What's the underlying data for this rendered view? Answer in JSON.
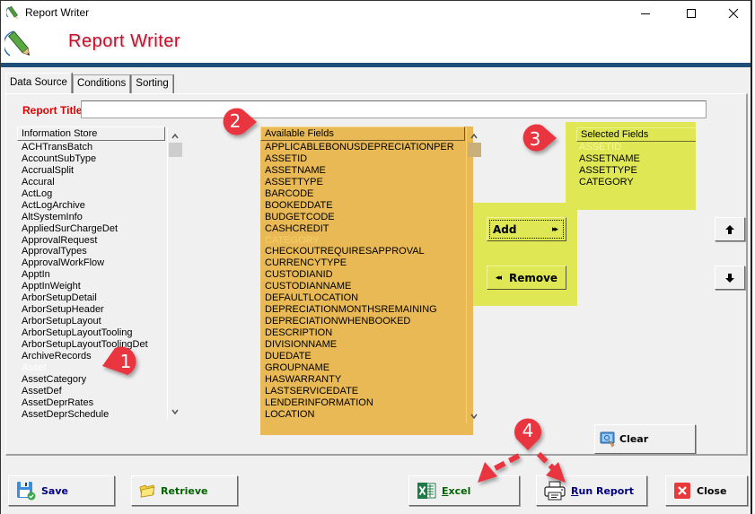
{
  "window": {
    "title": "Report Writer",
    "controls": {
      "minimize": "minimize",
      "maximize": "maximize",
      "close": "close"
    }
  },
  "header": {
    "heading": "Report Writer"
  },
  "tabs": [
    {
      "label": "Data Source",
      "active": true
    },
    {
      "label": "Conditions",
      "active": false
    },
    {
      "label": "Sorting",
      "active": false
    }
  ],
  "report_title": {
    "label": "Report Title",
    "value": ""
  },
  "information_store": {
    "header": "Information Store",
    "items": [
      "ACHTransBatch",
      "AccountSubType",
      "AccrualSplit",
      "Accural",
      "ActLog",
      "ActLogArchive",
      "AltSystemInfo",
      "AppliedSurChargeDet",
      "ApprovalRequest",
      "ApprovalTypes",
      "ApprovalWorkFlow",
      "ApptIn",
      "ApptInWeight",
      "ArborSetupDetail",
      "ArborSetupHeader",
      "ArborSetupLayout",
      "ArborSetupLayoutTooling",
      "ArborSetupLayoutToolingDet",
      "ArchiveRecords",
      "Asset",
      "AssetCategory",
      "AssetDef",
      "AssetDeprRates",
      "AssetDeprSchedule"
    ],
    "selected": "Asset"
  },
  "available_fields": {
    "header": "Available Fields",
    "items": [
      "APPLICABLEBONUSDEPRECIATIONPER",
      "ASSETID",
      "ASSETNAME",
      "ASSETTYPE",
      "BARCODE",
      "BOOKEDDATE",
      "BUDGETCODE",
      "CASHCREDIT",
      "CATEGORY",
      "CHECKOUTREQUIRESAPPROVAL",
      "CURRENCYTYPE",
      "CUSTODIANID",
      "CUSTODIANNAME",
      "DEFAULTLOCATION",
      "DEPRECIATIONMONTHSREMAINING",
      "DEPRECIATIONWHENBOOKED",
      "DESCRIPTION",
      "DIVISIONNAME",
      "DUEDATE",
      "GROUPNAME",
      "HASWARRANTY",
      "LASTSERVICEDATE",
      "LENDERINFORMATION",
      "LOCATION"
    ],
    "selected": "CATEGORY"
  },
  "selected_fields": {
    "header": "Selected Fields",
    "items": [
      "ASSETID",
      "ASSETNAME",
      "ASSETTYPE",
      "CATEGORY"
    ],
    "selected": "ASSETID"
  },
  "buttons": {
    "add": "Add",
    "add_glyph": "▸▸",
    "remove": "Remove",
    "remove_glyph": "◂◂",
    "move_up": "↑",
    "move_down": "↓",
    "clear": "Clear",
    "save": "Save",
    "retrieve": "Retrieve",
    "excel": "Excel",
    "run_report": "Run Report",
    "close": "Close"
  },
  "annotations": [
    {
      "number": "1",
      "target": "Information Store list"
    },
    {
      "number": "2",
      "target": "Available Fields list"
    },
    {
      "number": "3",
      "target": "Selected Fields list"
    },
    {
      "number": "4",
      "target": "Excel / Run Report buttons"
    }
  ],
  "colors": {
    "heading_red": "#c8102e",
    "header_blue": "#1f4e79",
    "available_highlight": "#e8b954",
    "selected_highlight": "#dfe854",
    "annotation_red": "#e8343f"
  }
}
